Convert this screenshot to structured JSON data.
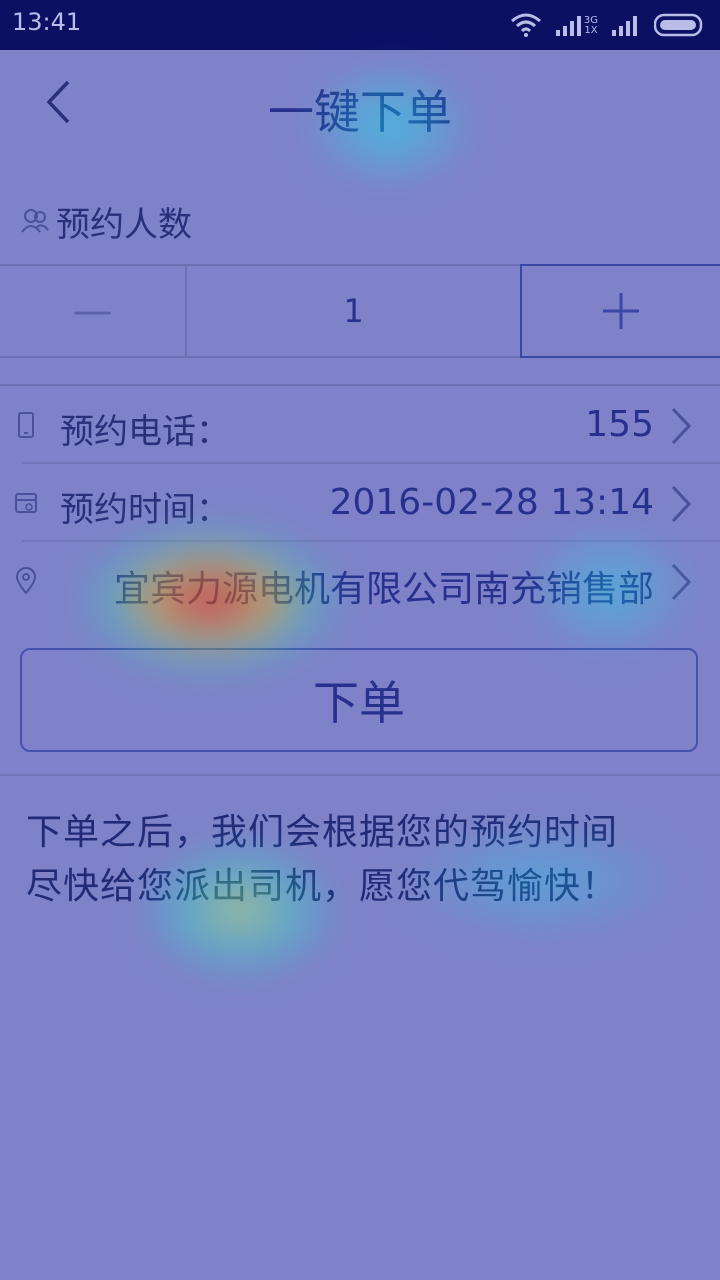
{
  "status_bar": {
    "time": "13:41",
    "network_label_top": "3G",
    "network_label_bottom": "1X"
  },
  "header": {
    "title": "一键下单",
    "back_icon": "chevron-left-icon"
  },
  "people_section": {
    "label": "预约人数",
    "icon": "people-icon"
  },
  "stepper": {
    "minus_label": "—",
    "value": "1",
    "plus_icon": "plus-icon"
  },
  "form": {
    "phone": {
      "label": "预约电话：",
      "value": "155",
      "icon": "phone-icon"
    },
    "time": {
      "label": "预约时间：",
      "value": "2016-02-28 13:14",
      "icon": "calendar-icon"
    },
    "address": {
      "value": "宜宾力源电机有限公司南充销售部",
      "icon": "location-icon"
    }
  },
  "order_button": {
    "label": "下单"
  },
  "notice": {
    "line1": "下单之后，我们会根据您的预约时间",
    "line2": "尽快给您派出司机，愿您代驾愉快！"
  },
  "colors": {
    "background": "#7f82c8",
    "status_bar": "#0d0f63",
    "text": "#27308d"
  }
}
